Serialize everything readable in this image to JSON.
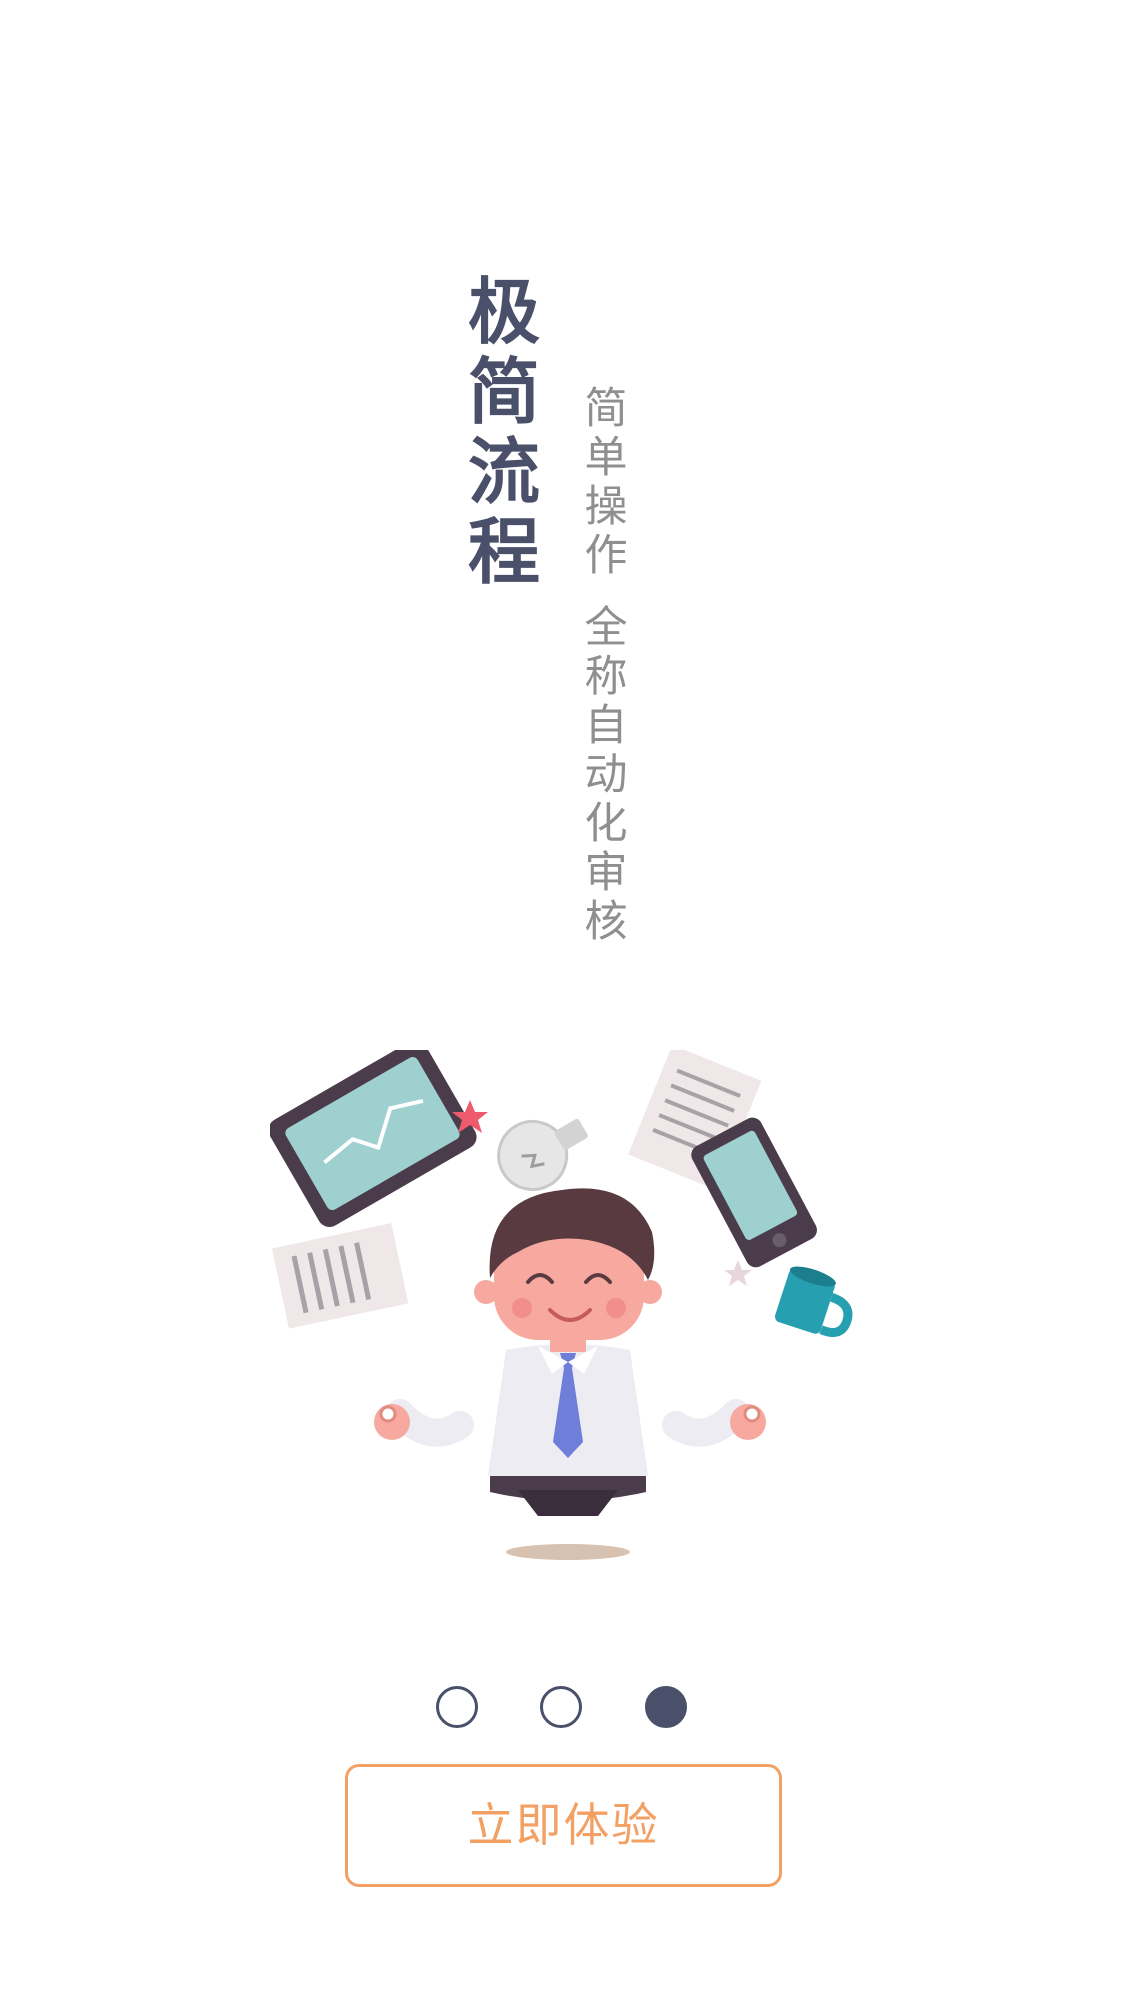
{
  "hero": {
    "title": "极简流程",
    "subtitle_line1": "简单操作",
    "subtitle_line2": "全称自动化审核"
  },
  "pager": {
    "total": 3,
    "active_index": 3
  },
  "cta": {
    "label": "立即体验"
  },
  "colors": {
    "title": "#4a4f6a",
    "subtitle": "#8f8f8f",
    "accent": "#f3a064",
    "dot": "#4a4f6a"
  },
  "illustration": {
    "icons": [
      "tablet-icon",
      "document-icon",
      "lightbulb-icon",
      "smartphone-icon",
      "mug-icon",
      "star-icon",
      "meditating-businessman-illustration"
    ]
  }
}
